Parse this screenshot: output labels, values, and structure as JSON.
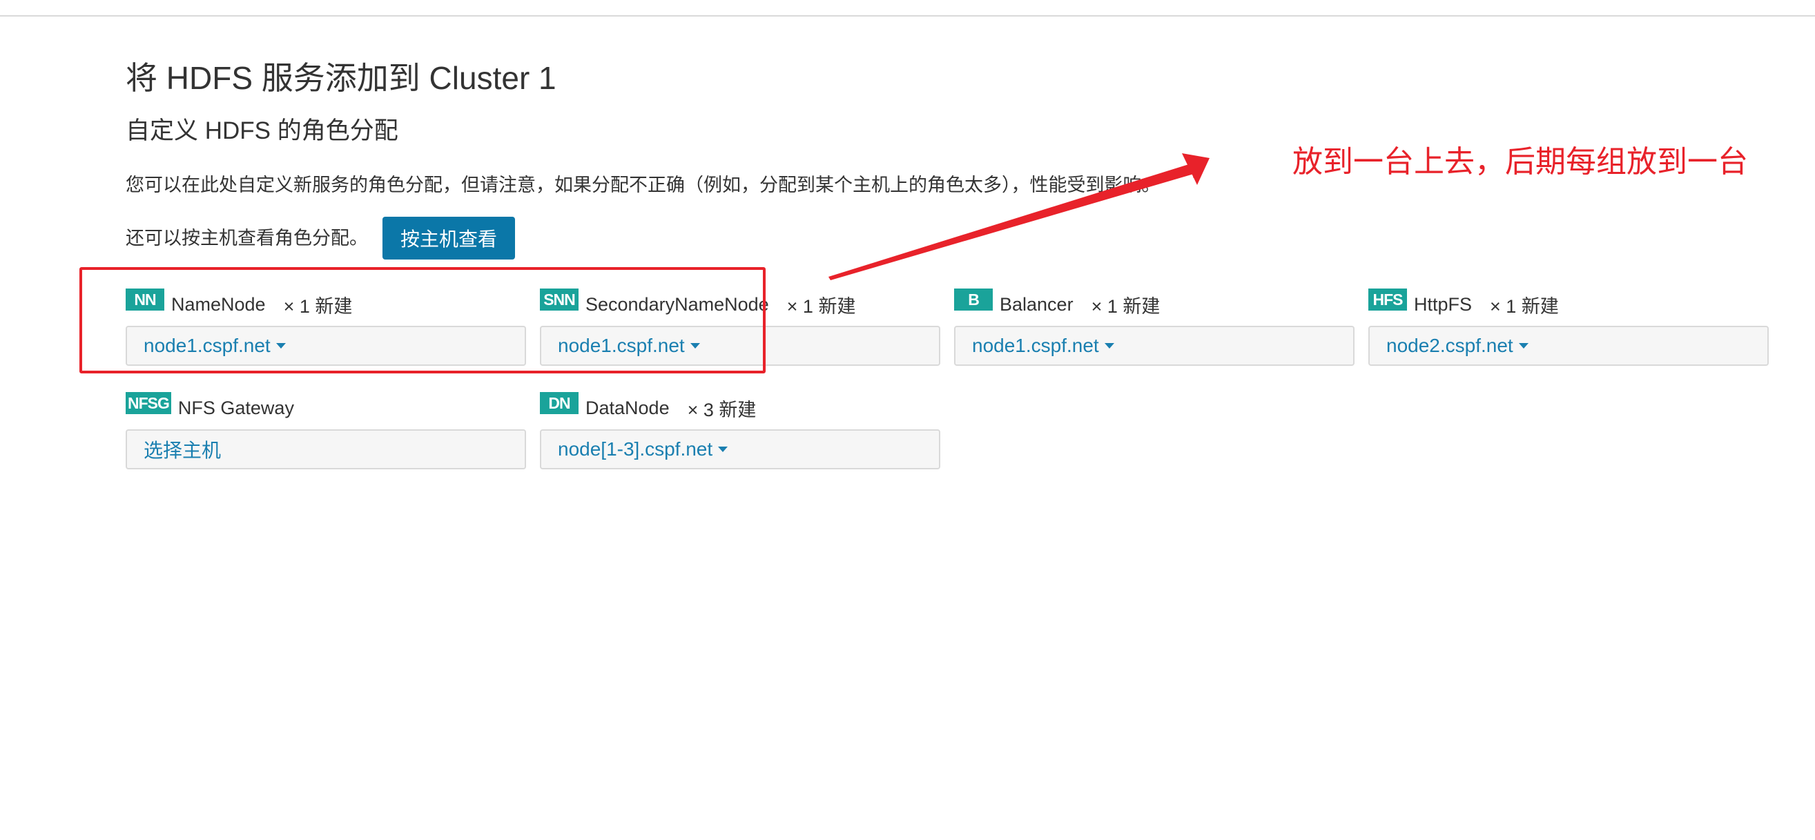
{
  "page": {
    "title": "将 HDFS 服务添加到 Cluster 1",
    "subtitle": "自定义 HDFS 的角色分配",
    "description": "您可以在此处自定义新服务的角色分配，但请注意，如果分配不正确（例如，分配到某个主机上的角色太多），性能受到影响。",
    "view_by_host_hint": "还可以按主机查看角色分配。",
    "view_by_host_button": "按主机查看"
  },
  "roles": [
    {
      "badge": "NN",
      "name": "NameNode",
      "count": "× 1 新建",
      "host": "node1.cspf.net",
      "has_caret": true
    },
    {
      "badge": "SNN",
      "name": "SecondaryNameNode",
      "count": "× 1 新建",
      "host": "node1.cspf.net",
      "has_caret": true
    },
    {
      "badge": "B",
      "name": "Balancer",
      "count": "× 1 新建",
      "host": "node1.cspf.net",
      "has_caret": true
    },
    {
      "badge": "HFS",
      "name": "HttpFS",
      "count": "× 1 新建",
      "host": "node2.cspf.net",
      "has_caret": true
    },
    {
      "badge": "NFSG",
      "name": "NFS Gateway",
      "count": "",
      "host": "选择主机",
      "has_caret": false
    },
    {
      "badge": "DN",
      "name": "DataNode",
      "count": "× 3 新建",
      "host": "node[1-3].cspf.net",
      "has_caret": true
    }
  ],
  "annotation": {
    "text": "放到一台上去，后期每组放到一台",
    "color": "#e8222a"
  },
  "colors": {
    "badge": "#1aa39a",
    "button": "#0b77a8",
    "link": "#1a7fb0",
    "annotation": "#e8222a"
  }
}
